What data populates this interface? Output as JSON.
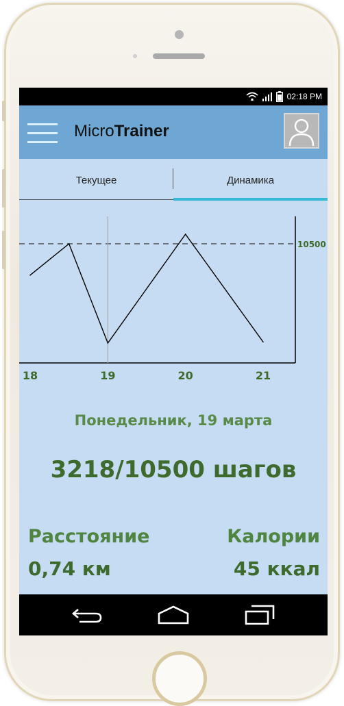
{
  "status_bar": {
    "time": "02:18 PM",
    "icons": [
      "wifi-icon",
      "signal-icon",
      "battery-icon"
    ]
  },
  "app": {
    "title_light": "Micro",
    "title_bold": "Trainer"
  },
  "tabs": [
    {
      "label": "Текущее",
      "selected": false
    },
    {
      "label": "Динамика",
      "selected": true
    }
  ],
  "chart_data": {
    "type": "line",
    "x": [
      18,
      18.5,
      19,
      20,
      21
    ],
    "categories": [
      "18",
      "19",
      "20",
      "21"
    ],
    "values": [
      8200,
      10500,
      3218,
      11200,
      3300
    ],
    "goal_line": {
      "value": 10500,
      "label": "10500"
    },
    "selected_x": 19,
    "xlim": [
      18,
      21
    ],
    "grid": false
  },
  "summary": {
    "date": "Понедельник, 19 марта",
    "steps": "3218/10500 шагов",
    "distance_label": "Расстояние",
    "distance_value": "0,74 км",
    "calories_label": "Калории",
    "calories_value": "45 ккал"
  },
  "nav": {
    "icons": [
      "back-icon",
      "home-icon",
      "recent-apps-icon"
    ]
  },
  "colors": {
    "appbar": "#6ea7d3",
    "screen_bg": "#c6dcf3",
    "accent": "#35b8d4",
    "text_green": "#3e6a2e"
  }
}
